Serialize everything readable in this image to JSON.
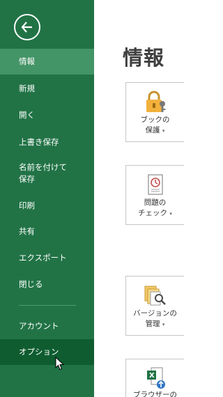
{
  "nav": {
    "items": [
      {
        "label": "情報",
        "state": "active"
      },
      {
        "label": "新規"
      },
      {
        "label": "開く"
      },
      {
        "label": "上書き保存"
      },
      {
        "label": "名前を付けて保存",
        "lines": [
          "名前を付けて",
          "保存"
        ]
      },
      {
        "label": "印刷"
      },
      {
        "label": "共有"
      },
      {
        "label": "エクスポート"
      },
      {
        "label": "閉じる"
      },
      {
        "label": "アカウント"
      },
      {
        "label": "オプション",
        "state": "hover"
      }
    ]
  },
  "main": {
    "title": "情報",
    "tiles": [
      {
        "line1": "ブックの",
        "line2": "保護",
        "icon": "lock-key-icon"
      },
      {
        "line1": "問題の",
        "line2": "チェック",
        "icon": "inspect-document-icon"
      },
      {
        "line1": "バージョンの",
        "line2": "管理",
        "icon": "version-search-icon"
      },
      {
        "line1": "ブラウザーの",
        "line2": "",
        "icon": "excel-upload-icon"
      }
    ]
  },
  "colors": {
    "sidebar": "#217346",
    "active": "#439467",
    "hover": "#0e5c30"
  }
}
